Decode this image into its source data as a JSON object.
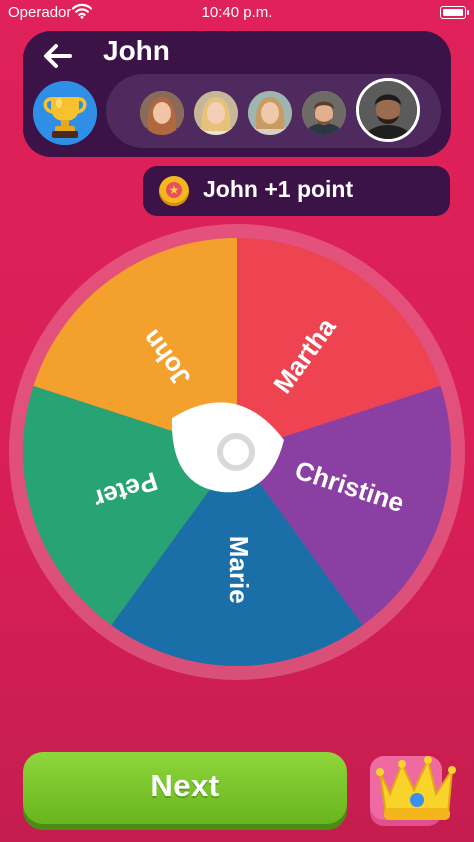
{
  "status_bar": {
    "carrier": "Operador",
    "time": "10:40 p.m."
  },
  "header": {
    "title": "John",
    "back_icon": "arrow-left-icon",
    "trophy_icon": "trophy-icon",
    "players": [
      {
        "name": "Martha",
        "selected": false
      },
      {
        "name": "Christine",
        "selected": false
      },
      {
        "name": "Marie",
        "selected": false
      },
      {
        "name": "Peter",
        "selected": false
      },
      {
        "name": "John",
        "selected": true
      }
    ]
  },
  "points_badge": {
    "text": "John +1 point",
    "icon": "coin-star-icon"
  },
  "wheel": {
    "segments": [
      {
        "label": "Martha",
        "color": "#ee4350"
      },
      {
        "label": "Christine",
        "color": "#8a3fa2"
      },
      {
        "label": "Marie",
        "color": "#1b6fa8"
      },
      {
        "label": "Peter",
        "color": "#28a374"
      },
      {
        "label": "John",
        "color": "#f3a12c"
      }
    ],
    "rim_color": "#ffffff",
    "pointer_icon": "spinner-pointer-icon"
  },
  "next_button": {
    "label": "Next"
  },
  "crown_button": {
    "icon": "crown-icon"
  }
}
